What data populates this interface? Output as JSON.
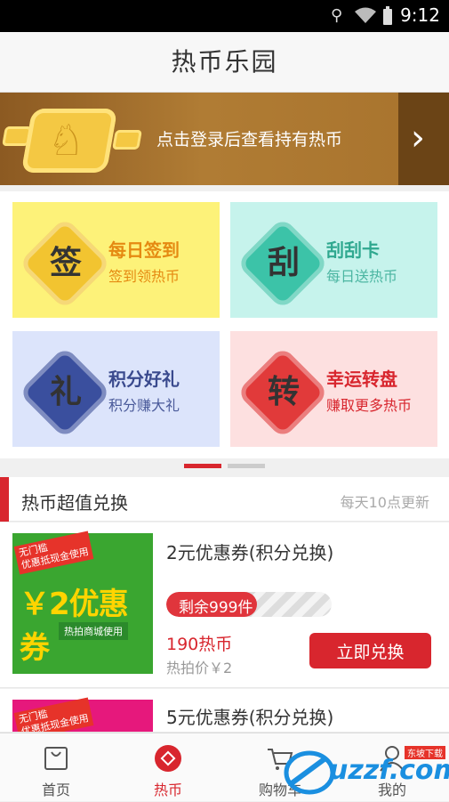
{
  "status_bar": {
    "time": "9:12",
    "icons": [
      "location-icon",
      "wifi-icon",
      "battery-icon"
    ]
  },
  "header": {
    "title": "热币乐园"
  },
  "banner": {
    "login_text": "点击登录后查看持有热币",
    "arrow_icon": "chevron-right-icon"
  },
  "tiles": [
    {
      "badge": "签",
      "title": "每日签到",
      "sub": "签到领热币",
      "bg": "#fdf279",
      "badge_color": "#f2c430",
      "title_color": "#e58a12",
      "sub_color": "#e58a12"
    },
    {
      "badge": "刮",
      "title": "刮刮卡",
      "sub": "每日送热币",
      "bg": "#c6f3ec",
      "badge_color": "#3cc3a8",
      "title_color": "#2fa88f",
      "sub_color": "#4cb6a2"
    },
    {
      "badge": "礼",
      "title": "积分好礼",
      "sub": "积分赚大礼",
      "bg": "#dce4fb",
      "badge_color": "#3a4f9e",
      "title_color": "#3a4a8e",
      "sub_color": "#4a5a9a"
    },
    {
      "badge": "转",
      "title": "幸运转盘",
      "sub": "赚取更多热币",
      "bg": "#fde0e0",
      "badge_color": "#e13a3a",
      "title_color": "#d8262e",
      "sub_color": "#d8262e"
    }
  ],
  "pager": {
    "active": 0,
    "count": 2
  },
  "section": {
    "title": "热币超值兑换",
    "note": "每天10点更新"
  },
  "items": [
    {
      "name": "2元优惠券(积分兑换)",
      "stock_label": "剩余999件",
      "stock_fraction": 0.55,
      "price": "190热币",
      "original_price": "热拍价￥2",
      "button": "立即兑换",
      "thumb": {
        "tag": "无门槛\n优惠抵现金使用",
        "main": "￥2优惠券",
        "sub": "热拍商城使用",
        "bg": "#3aa630"
      }
    },
    {
      "name": "5元优惠券(积分兑换)",
      "thumb": {
        "tag": "无门槛\n优惠抵现金使用",
        "bg": "#e6187c"
      }
    }
  ],
  "tabbar": [
    {
      "label": "首页",
      "icon": "bag-icon",
      "active": false
    },
    {
      "label": "热币",
      "icon": "coin-diamond-icon",
      "active": true
    },
    {
      "label": "购物车",
      "icon": "cart-icon",
      "active": false
    },
    {
      "label": "我的",
      "icon": "user-icon",
      "active": false
    }
  ],
  "watermark": {
    "text": "uzzf.com",
    "sub": "东坡下载"
  },
  "colors": {
    "accent": "#d8262e",
    "banner": "#a8732d"
  }
}
